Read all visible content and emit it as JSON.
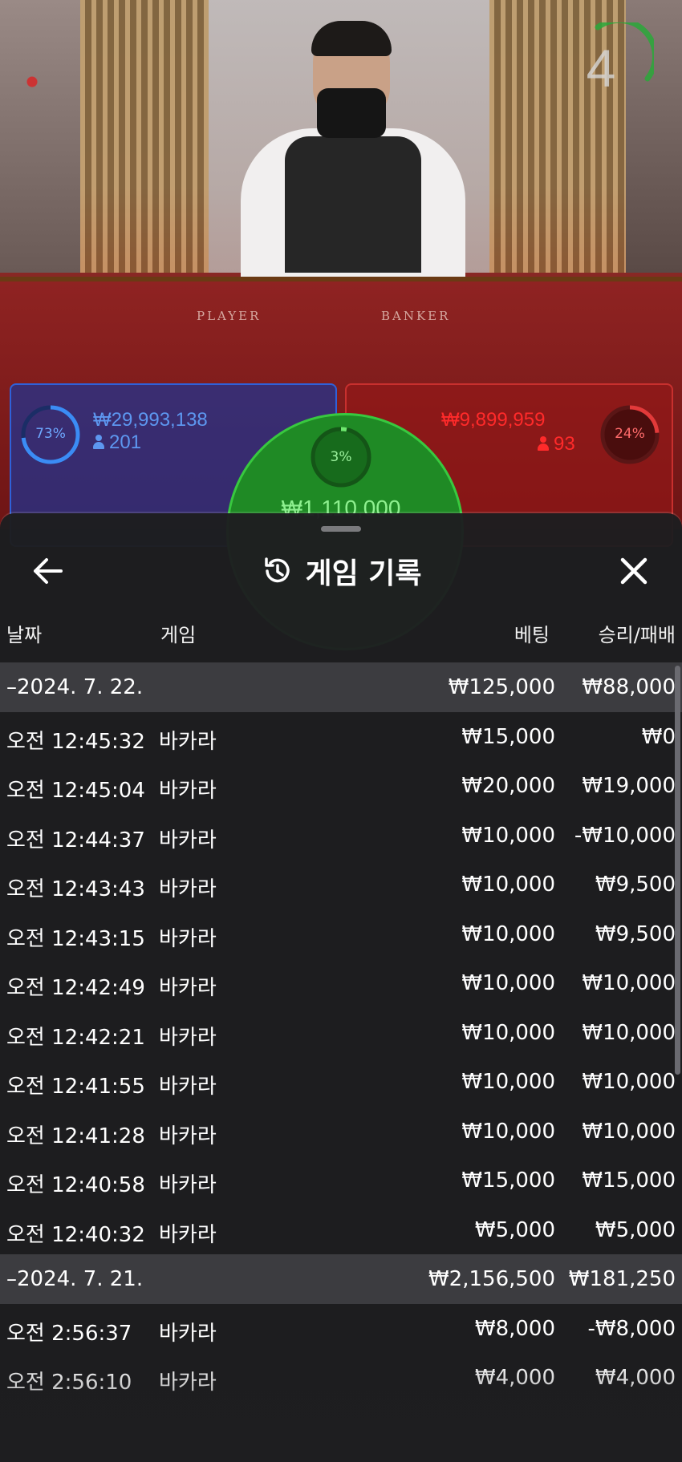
{
  "video": {
    "timer": "4",
    "table_player": "PLAYER",
    "table_banker": "BANKER",
    "player": {
      "percent": "73%",
      "amount": "₩29,993,138",
      "players": "201"
    },
    "banker": {
      "percent": "24%",
      "amount": "₩9,899,959",
      "players": "93"
    },
    "tie": {
      "percent": "3%",
      "amount": "₩1,110,000"
    }
  },
  "sheet": {
    "title": "게임 기록",
    "columns": {
      "date": "날짜",
      "game": "게임",
      "bet": "베팅",
      "result": "승리/패배"
    },
    "rows": [
      {
        "type": "date",
        "time": "–2024. 7. 22.",
        "game": "",
        "bet": "₩125,000",
        "result": "₩88,000"
      },
      {
        "type": "game",
        "time": "오전 12:45:32",
        "game": "바카라",
        "bet": "₩15,000",
        "result": "₩0"
      },
      {
        "type": "game",
        "time": "오전 12:45:04",
        "game": "바카라",
        "bet": "₩20,000",
        "result": "₩19,000"
      },
      {
        "type": "game",
        "time": "오전 12:44:37",
        "game": "바카라",
        "bet": "₩10,000",
        "result": "-₩10,000"
      },
      {
        "type": "game",
        "time": "오전 12:43:43",
        "game": "바카라",
        "bet": "₩10,000",
        "result": "₩9,500"
      },
      {
        "type": "game",
        "time": "오전 12:43:15",
        "game": "바카라",
        "bet": "₩10,000",
        "result": "₩9,500"
      },
      {
        "type": "game",
        "time": "오전 12:42:49",
        "game": "바카라",
        "bet": "₩10,000",
        "result": "₩10,000"
      },
      {
        "type": "game",
        "time": "오전 12:42:21",
        "game": "바카라",
        "bet": "₩10,000",
        "result": "₩10,000"
      },
      {
        "type": "game",
        "time": "오전 12:41:55",
        "game": "바카라",
        "bet": "₩10,000",
        "result": "₩10,000"
      },
      {
        "type": "game",
        "time": "오전 12:41:28",
        "game": "바카라",
        "bet": "₩10,000",
        "result": "₩10,000"
      },
      {
        "type": "game",
        "time": "오전 12:40:58",
        "game": "바카라",
        "bet": "₩15,000",
        "result": "₩15,000"
      },
      {
        "type": "game",
        "time": "오전 12:40:32",
        "game": "바카라",
        "bet": "₩5,000",
        "result": "₩5,000"
      },
      {
        "type": "date",
        "time": "–2024. 7. 21.",
        "game": "",
        "bet": "₩2,156,500",
        "result": "₩181,250"
      },
      {
        "type": "game",
        "time": "오전 2:56:37",
        "game": "바카라",
        "bet": "₩8,000",
        "result": "-₩8,000"
      },
      {
        "type": "game",
        "time": "오전 2:56:10",
        "game": "바카라",
        "bet": "₩4,000",
        "result": "₩4,000"
      }
    ]
  },
  "colors": {
    "player_blue": "#2f61d9",
    "banker_red": "#c8302e",
    "tie_green": "#38c93f",
    "sheet_bg": "#1e1e20",
    "date_row_bg": "#3c3c40"
  },
  "icons": {
    "back": "arrow-left-icon",
    "close": "close-icon",
    "title": "history-icon",
    "players": "person-icon"
  }
}
